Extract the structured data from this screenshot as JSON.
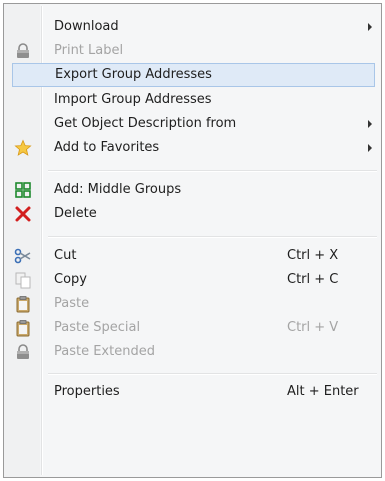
{
  "menu": {
    "items": [
      {
        "label": "Download",
        "shortcut": "",
        "icon": "",
        "submenu": true,
        "disabled": false
      },
      {
        "label": "Print Label",
        "shortcut": "",
        "icon": "lock-icon",
        "submenu": false,
        "disabled": true
      },
      {
        "label": "Export Group Addresses",
        "shortcut": "",
        "icon": "",
        "submenu": false,
        "disabled": false,
        "highlighted": true
      },
      {
        "label": "Import Group Addresses",
        "shortcut": "",
        "icon": "",
        "submenu": false,
        "disabled": false
      },
      {
        "label": "Get Object Description from",
        "shortcut": "",
        "icon": "",
        "submenu": true,
        "disabled": false
      },
      {
        "label": "Add to Favorites",
        "shortcut": "",
        "icon": "star-icon",
        "submenu": true,
        "disabled": false
      },
      {
        "label": "Add: Middle Groups",
        "shortcut": "",
        "icon": "grid-icon",
        "submenu": false,
        "disabled": false
      },
      {
        "label": "Delete",
        "shortcut": "",
        "icon": "delete-icon",
        "submenu": false,
        "disabled": false
      },
      {
        "label": "Cut",
        "shortcut": "Ctrl + X",
        "icon": "scissors-icon",
        "submenu": false,
        "disabled": false
      },
      {
        "label": "Copy",
        "shortcut": "Ctrl + C",
        "icon": "copy-icon",
        "submenu": false,
        "disabled": false
      },
      {
        "label": "Paste",
        "shortcut": "",
        "icon": "clipboard-icon",
        "submenu": false,
        "disabled": true
      },
      {
        "label": "Paste Special",
        "shortcut": "Ctrl + V",
        "icon": "clipboard-icon",
        "submenu": false,
        "disabled": true
      },
      {
        "label": "Paste Extended",
        "shortcut": "",
        "icon": "lock-icon",
        "submenu": false,
        "disabled": true
      },
      {
        "label": "Properties",
        "shortcut": "Alt + Enter",
        "icon": "",
        "submenu": false,
        "disabled": false
      }
    ]
  }
}
